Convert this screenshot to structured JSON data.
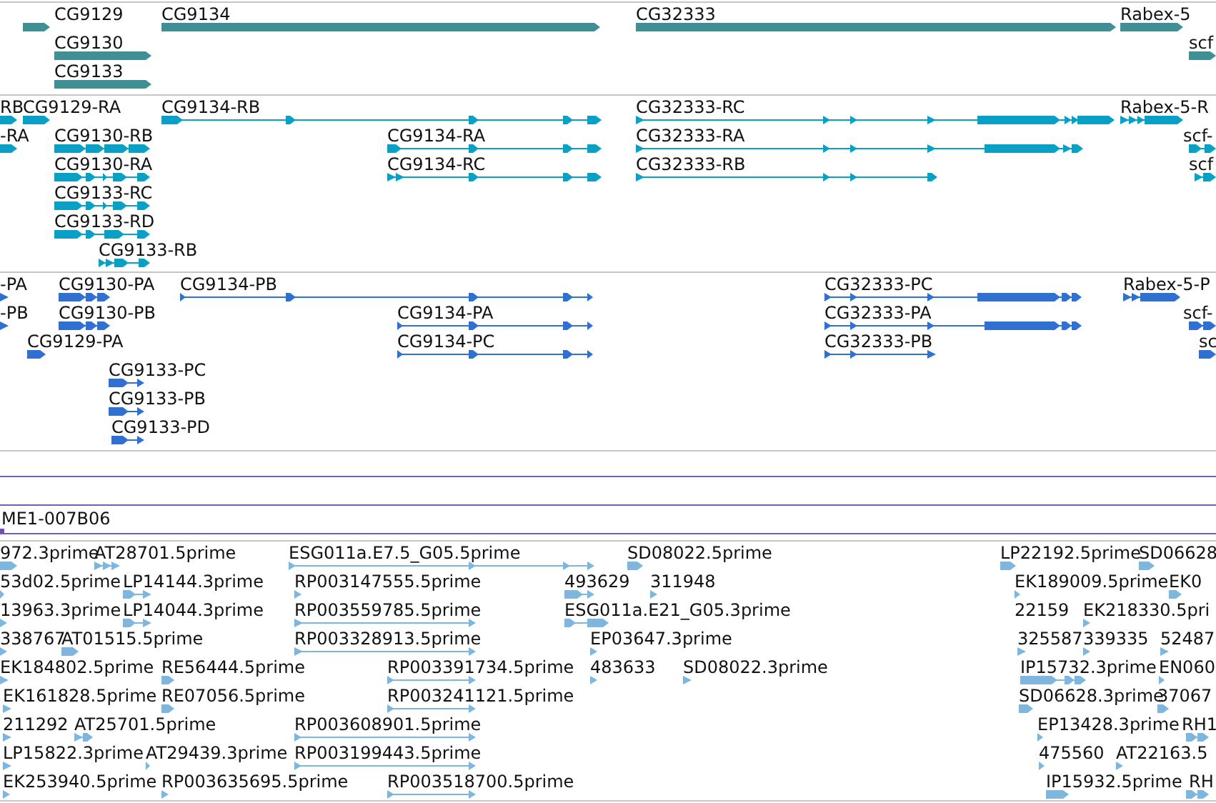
{
  "tracks": [
    {
      "kind": "gene",
      "features": [
        {
          "label": "CG9129"
        },
        {
          "label": "CG9134"
        },
        {
          "label": "CG32333"
        },
        {
          "label": "Rabex-5"
        },
        {
          "label": "CG9130"
        },
        {
          "label": "scf"
        },
        {
          "label": "CG9133"
        }
      ]
    },
    {
      "kind": "transcript",
      "features": [
        {
          "label": "RB"
        },
        {
          "label": "CG9129-RA"
        },
        {
          "label": "CG9134-RB"
        },
        {
          "label": "CG32333-RC"
        },
        {
          "label": "Rabex-5-R"
        },
        {
          "label": "-RA"
        },
        {
          "label": "CG9130-RB"
        },
        {
          "label": "CG9134-RA"
        },
        {
          "label": "CG32333-RA"
        },
        {
          "label": "scf-"
        },
        {
          "label": "CG9130-RA"
        },
        {
          "label": "CG9134-RC"
        },
        {
          "label": "CG32333-RB"
        },
        {
          "label": "scf"
        },
        {
          "label": "CG9133-RC"
        },
        {
          "label": "CG9133-RD"
        },
        {
          "label": "CG9133-RB"
        }
      ]
    },
    {
      "kind": "protein",
      "features": [
        {
          "label": "-PA"
        },
        {
          "label": "CG9130-PA"
        },
        {
          "label": "CG9134-PB"
        },
        {
          "label": "CG32333-PC"
        },
        {
          "label": "Rabex-5-P"
        },
        {
          "label": "-PB"
        },
        {
          "label": "CG9130-PB"
        },
        {
          "label": "CG9134-PA"
        },
        {
          "label": "CG32333-PA"
        },
        {
          "label": "scf-"
        },
        {
          "label": "CG9129-PA"
        },
        {
          "label": "CG9134-PC"
        },
        {
          "label": "CG32333-PB"
        },
        {
          "label": "sc"
        },
        {
          "label": "CG9133-PC"
        },
        {
          "label": "CG9133-PB"
        },
        {
          "label": "CG9133-PD"
        }
      ]
    },
    {
      "kind": "clone",
      "features": [
        {
          "label": "ME1-007B06"
        }
      ]
    },
    {
      "kind": "est",
      "features": [
        {
          "label": "972.3prime"
        },
        {
          "label": "AT28701.5prime"
        },
        {
          "label": "ESG011a.E7.5_G05.5prime"
        },
        {
          "label": "SD08022.5prime"
        },
        {
          "label": "LP22192.5prime"
        },
        {
          "label": "SD06628"
        },
        {
          "label": "53d02.5prime"
        },
        {
          "label": "LP14144.3prime"
        },
        {
          "label": "RP003147555.5prime"
        },
        {
          "label": "493629"
        },
        {
          "label": "311948"
        },
        {
          "label": "EK189009.5prime"
        },
        {
          "label": "EK0"
        },
        {
          "label": "13963.3prime"
        },
        {
          "label": "LP14044.3prime"
        },
        {
          "label": "RP003559785.5prime"
        },
        {
          "label": "ESG011a.E21_G05.3prime"
        },
        {
          "label": "22159"
        },
        {
          "label": "EK218330.5pri"
        },
        {
          "label": "338767"
        },
        {
          "label": "AT01515.5prime"
        },
        {
          "label": "RP003328913.5prime"
        },
        {
          "label": "EP03647.3prime"
        },
        {
          "label": "325587"
        },
        {
          "label": "339335"
        },
        {
          "label": "52487"
        },
        {
          "label": "EK184802.5prime"
        },
        {
          "label": "RE56444.5prime"
        },
        {
          "label": "RP003391734.5prime"
        },
        {
          "label": "483633"
        },
        {
          "label": "SD08022.3prime"
        },
        {
          "label": "IP15732.3prime"
        },
        {
          "label": "EN060"
        },
        {
          "label": "EK161828.5prime"
        },
        {
          "label": "RE07056.5prime"
        },
        {
          "label": "RP003241121.5prime"
        },
        {
          "label": "SD06628.3prime"
        },
        {
          "label": "37067"
        },
        {
          "label": "211292"
        },
        {
          "label": "AT25701.5prime"
        },
        {
          "label": "RP003608901.5prime"
        },
        {
          "label": "EP13428.3prime"
        },
        {
          "label": "RH1"
        },
        {
          "label": "LP15822.3prime"
        },
        {
          "label": "AT29439.3prime"
        },
        {
          "label": "RP003199443.5prime"
        },
        {
          "label": "475560"
        },
        {
          "label": "AT22163.5"
        },
        {
          "label": "EK253940.5prime"
        },
        {
          "label": "RP003635695.5prime"
        },
        {
          "label": "RP003518700.5prime"
        },
        {
          "label": "IP15932.5prime"
        },
        {
          "label": "RH"
        }
      ]
    }
  ]
}
